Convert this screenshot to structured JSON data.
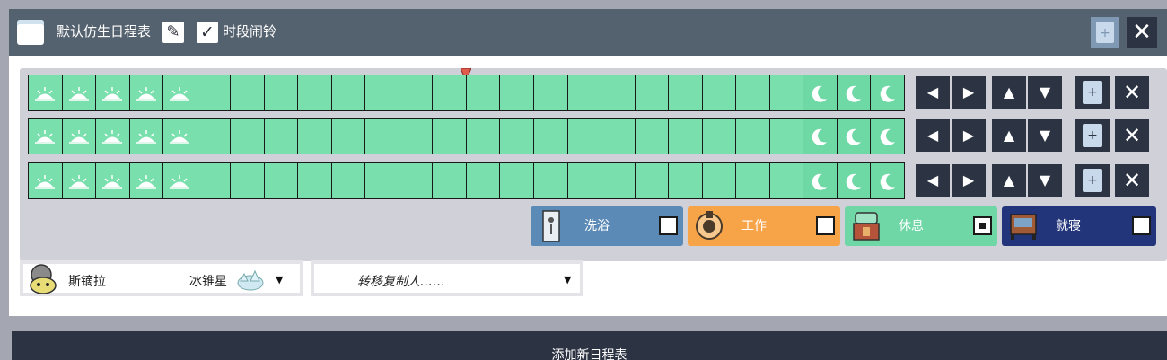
{
  "header": {
    "title": "默认仿生日程表",
    "alarm_label": "时段闹铃",
    "alarm_checked": true
  },
  "schedule": {
    "rows": [
      [
        "sun",
        "sun",
        "sun",
        "sun",
        "sun",
        "",
        "",
        "",
        "",
        "",
        "",
        "",
        "",
        "",
        "",
        "",
        "",
        "",
        "",
        "",
        "",
        "",
        "",
        "moon",
        "moon",
        "moon"
      ],
      [
        "sun",
        "sun",
        "sun",
        "sun",
        "sun",
        "",
        "",
        "",
        "",
        "",
        "",
        "",
        "",
        "",
        "",
        "",
        "",
        "",
        "",
        "",
        "",
        "",
        "",
        "moon",
        "moon",
        "moon"
      ],
      [
        "sun",
        "sun",
        "sun",
        "sun",
        "sun",
        "",
        "",
        "",
        "",
        "",
        "",
        "",
        "",
        "",
        "",
        "",
        "",
        "",
        "",
        "",
        "",
        "",
        "",
        "moon",
        "moon",
        "moon"
      ]
    ],
    "current_hour_marker": 12
  },
  "groups": [
    {
      "label": "洗浴",
      "color": "#5a8ab5",
      "checked": false,
      "icon": "shower-icon"
    },
    {
      "label": "工作",
      "color": "#f7a449",
      "checked": false,
      "icon": "work-icon"
    },
    {
      "label": "休息",
      "color": "#6fd6a6",
      "checked": true,
      "icon": "recreation-icon"
    },
    {
      "label": "就寝",
      "color": "#23357a",
      "checked": false,
      "icon": "bed-icon"
    }
  ],
  "assignee": {
    "name": "斯镝拉",
    "planet": "冰锥星"
  },
  "transfer": {
    "placeholder": "转移复制人……"
  },
  "add_button_label": "添加新日程表",
  "colors": {
    "block": "#78dfad",
    "header": "#54616e",
    "dark_button": "#2c3342"
  }
}
